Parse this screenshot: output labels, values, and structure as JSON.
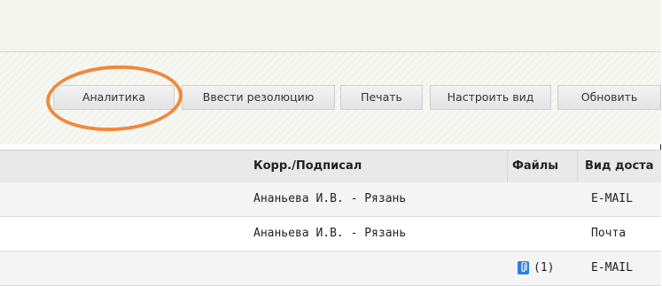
{
  "toolbar": {
    "buttons": [
      {
        "label": "Аналитика"
      },
      {
        "label": "Ввести резолюцию"
      },
      {
        "label": "Печать"
      },
      {
        "label": "Настроить вид"
      },
      {
        "label": "Обновить"
      }
    ],
    "highlight_color": "#ef8a3c"
  },
  "table": {
    "columns": [
      "Корр./Подписал",
      "Файлы",
      "Вид доста"
    ],
    "rows": [
      {
        "corr": "Ананьева И.В. - Рязань",
        "files": "",
        "delivery": "E-MAIL"
      },
      {
        "corr": "Ананьева И.В. - Рязань",
        "files": "",
        "delivery": "Почта"
      },
      {
        "corr": "",
        "files": "(1)",
        "delivery": "E-MAIL"
      }
    ],
    "attachment_icon": "paperclip-icon",
    "attachment_icon_color": "#2d7fd6"
  }
}
